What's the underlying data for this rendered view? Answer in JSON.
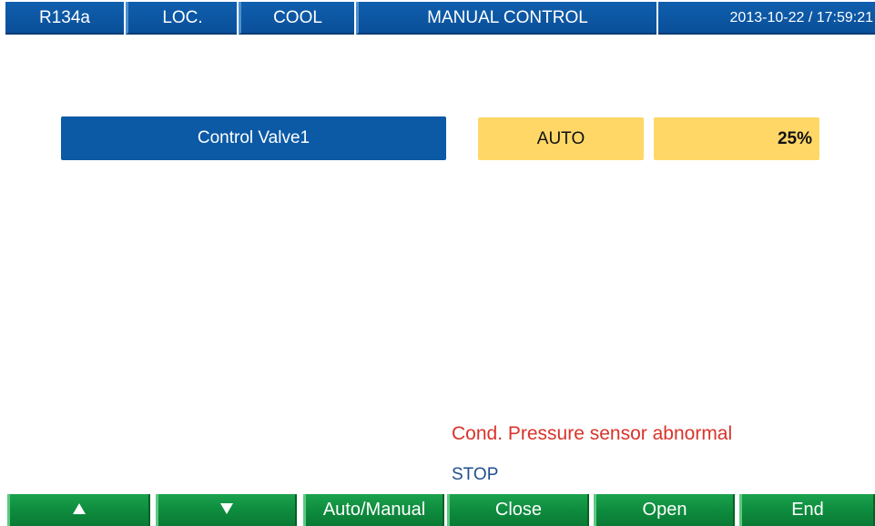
{
  "header": {
    "refrigerant": "R134a",
    "location": "LOC.",
    "mode": "COOL",
    "title": "MANUAL CONTROL",
    "datetime": "2013-10-22 / 17:59:21"
  },
  "control": {
    "name": "Control Valve1",
    "mode": "AUTO",
    "value": "25%"
  },
  "messages": {
    "alarm": "Cond. Pressure sensor abnormal",
    "status": "STOP"
  },
  "softkeys": {
    "up_icon": "triangle-up-icon",
    "down_icon": "triangle-down-icon",
    "auto_manual": "Auto/Manual",
    "close": "Close",
    "open": "Open",
    "end": "End"
  },
  "colors": {
    "header_blue": "#0c5aa6",
    "highlight_yellow": "#ffd766",
    "softkey_green": "#0d8a3d",
    "alarm_red": "#d9332a",
    "status_blue": "#1f4f8e"
  }
}
